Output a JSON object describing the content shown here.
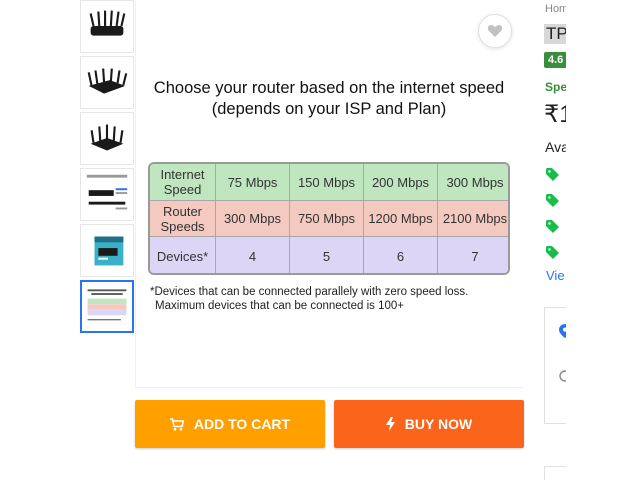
{
  "gallery": {
    "thumbnails": [
      {
        "name": "router-front"
      },
      {
        "name": "router-angle"
      },
      {
        "name": "router-back"
      },
      {
        "name": "router-specs"
      },
      {
        "name": "router-box"
      },
      {
        "name": "router-speed-chart",
        "selected": true
      }
    ]
  },
  "main_image": {
    "headline_line1": "Choose your router based on the internet speed",
    "headline_line2": "(depends on your ISP and Plan)",
    "table": {
      "rows": [
        {
          "label": "Internet Speed",
          "values": [
            "75 Mbps",
            "150 Mbps",
            "200 Mbps",
            "300 Mbps"
          ],
          "color": "#bfe6bf"
        },
        {
          "label": "Router Speeds",
          "values": [
            "300 Mbps",
            "750 Mbps",
            "1200 Mbps",
            "2100 Mbps"
          ],
          "color": "#f4c9c0"
        },
        {
          "label": "Devices*",
          "values": [
            "4",
            "5",
            "6",
            "7"
          ],
          "color": "#ddd5f5"
        }
      ]
    },
    "footnote_line1": "*Devices that can be connected parallely with zero speed loss.",
    "footnote_line2": "Maximum devices that can be connected is 100+"
  },
  "actions": {
    "add_to_cart": "ADD TO CART",
    "buy_now": "BUY NOW",
    "add_to_cart_color": "#ff9f00",
    "buy_now_color": "#fb641b"
  },
  "details": {
    "breadcrumb": "Hom",
    "title": "TP",
    "rating": "4.6",
    "special_price_label": "Spe",
    "price": "₹1",
    "available_offers": "Ava",
    "view_more": "Vie"
  }
}
